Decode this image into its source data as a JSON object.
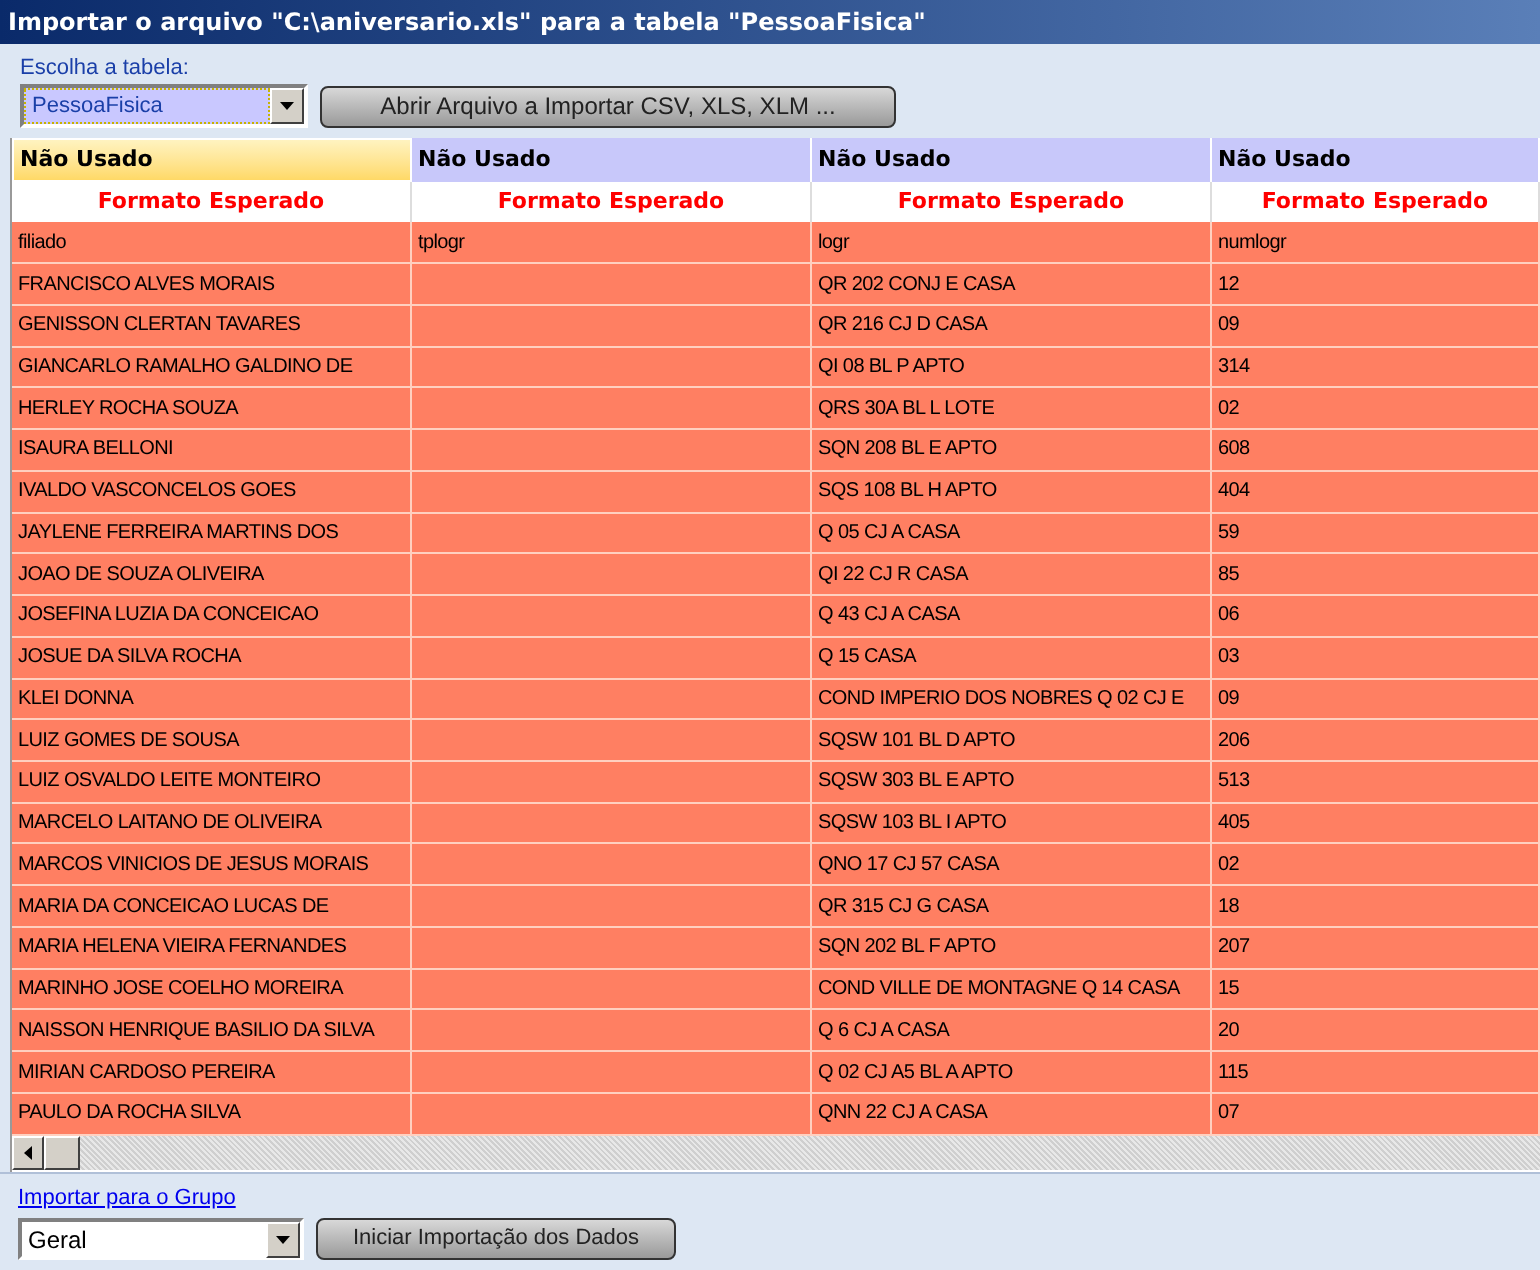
{
  "window": {
    "title": "Importar o arquivo \"C:\\aniversario.xls\" para a tabela \"PessoaFisica\""
  },
  "table_picker": {
    "label": "Escolha a tabela:",
    "value": "PessoaFisica"
  },
  "open_button": "Abrir Arquivo a Importar CSV, XLS, XLM ...",
  "columns": [
    {
      "header": "Não Usado",
      "selected": true,
      "format": "Formato Esperado"
    },
    {
      "header": "Não Usado",
      "selected": false,
      "format": "Formato Esperado"
    },
    {
      "header": "Não Usado",
      "selected": false,
      "format": "Formato Esperado"
    },
    {
      "header": "Não Usado",
      "selected": false,
      "format": "Formato Esperado"
    }
  ],
  "rows": [
    [
      "filiado",
      "tplogr",
      "logr",
      "numlogr"
    ],
    [
      "FRANCISCO ALVES MORAIS",
      "",
      "QR 202 CONJ E CASA",
      "12"
    ],
    [
      "GENISSON CLERTAN TAVARES",
      "",
      "QR 216 CJ D CASA",
      "09"
    ],
    [
      "GIANCARLO RAMALHO GALDINO DE",
      "",
      "QI 08 BL P APTO",
      "314"
    ],
    [
      "HERLEY ROCHA SOUZA",
      "",
      "QRS 30A BL L LOTE",
      "02"
    ],
    [
      "ISAURA BELLONI",
      "",
      "SQN 208 BL E APTO",
      "608"
    ],
    [
      "IVALDO VASCONCELOS GOES",
      "",
      "SQS 108 BL H APTO",
      "404"
    ],
    [
      "JAYLENE FERREIRA MARTINS DOS",
      "",
      "Q 05 CJ A CASA",
      "59"
    ],
    [
      "JOAO DE SOUZA OLIVEIRA",
      "",
      "QI 22 CJ R CASA",
      "85"
    ],
    [
      "JOSEFINA LUZIA DA CONCEICAO",
      "",
      "Q 43 CJ A CASA",
      "06"
    ],
    [
      "JOSUE DA SILVA ROCHA",
      "",
      "Q 15 CASA",
      "03"
    ],
    [
      "KLEI DONNA",
      "",
      "COND IMPERIO DOS NOBRES Q 02 CJ E",
      "09"
    ],
    [
      "LUIZ GOMES DE SOUSA",
      "",
      "SQSW 101 BL D APTO",
      "206"
    ],
    [
      "LUIZ OSVALDO LEITE MONTEIRO",
      "",
      "SQSW 303 BL E APTO",
      "513"
    ],
    [
      "MARCELO LAITANO DE OLIVEIRA",
      "",
      "SQSW 103 BL I APTO",
      "405"
    ],
    [
      "MARCOS VINICIOS DE JESUS MORAIS",
      "",
      "QNO 17 CJ 57 CASA",
      "02"
    ],
    [
      "MARIA DA CONCEICAO LUCAS DE",
      "",
      "QR 315 CJ G CASA",
      "18"
    ],
    [
      "MARIA HELENA VIEIRA FERNANDES",
      "",
      "SQN 202 BL F APTO",
      "207"
    ],
    [
      "MARINHO JOSE COELHO MOREIRA",
      "",
      "COND VILLE DE MONTAGNE Q 14 CASA",
      "15"
    ],
    [
      "NAISSON HENRIQUE BASILIO DA SILVA",
      "",
      "Q 6 CJ A CASA",
      "20"
    ],
    [
      "MIRIAN CARDOSO PEREIRA",
      "",
      "Q 02 CJ A5 BL A APTO",
      "115"
    ],
    [
      "PAULO DA ROCHA SILVA",
      "",
      "QNN 22 CJ A CASA",
      "07"
    ]
  ],
  "group_link": "Importar para o Grupo",
  "group_picker": {
    "value": "Geral"
  },
  "start_button": "Iniciar Importação dos Dados"
}
